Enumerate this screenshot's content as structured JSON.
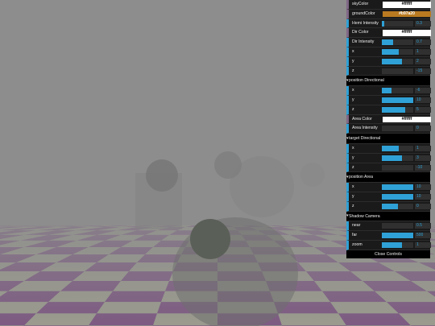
{
  "scene": {
    "colors": {
      "fog": "#8d8d8d",
      "floor_a": "#7d5a82",
      "floor_b": "#9a9a8e",
      "sphere": "#5a5a5a"
    }
  },
  "gui": {
    "colors": {
      "accent": "#2fa1d6",
      "bg": "#1a1a1a",
      "folder_bg": "#000000"
    },
    "rows": [
      {
        "kind": "color",
        "name": "skyColor-control",
        "label": "skyColor",
        "value": "#ffffff",
        "swatch": "#ffffff",
        "text_color": "#000000"
      },
      {
        "kind": "color",
        "name": "groundColor-control",
        "label": "groundColor",
        "value": "#b97a20",
        "swatch": "#b97a20",
        "text_color": "#ffffff"
      },
      {
        "kind": "slider",
        "name": "hemi-intensity-slider",
        "label": "Hemi Intensity",
        "value": "0.3",
        "fill": 0.08
      },
      {
        "kind": "color",
        "name": "dir-color-control",
        "label": "Dir Color",
        "value": "#ffffff",
        "swatch": "#ffffff",
        "text_color": "#000000"
      },
      {
        "kind": "slider",
        "name": "dir-intensity-slider",
        "label": "Dir Intensity",
        "value": "0.7",
        "fill": 0.35
      },
      {
        "kind": "slider",
        "name": "dir-x-slider",
        "label": "x",
        "value": "1",
        "fill": 0.55
      },
      {
        "kind": "slider",
        "name": "dir-y-slider",
        "label": "y",
        "value": "2",
        "fill": 0.65
      },
      {
        "kind": "slider",
        "name": "dir-z-slider",
        "label": "z",
        "value": "-15",
        "fill": 0.0
      },
      {
        "kind": "folder",
        "name": "folder-position-directional",
        "label": "position Directional"
      },
      {
        "kind": "slider",
        "name": "pos-dir-x-slider",
        "label": "x",
        "value": "-6",
        "fill": 0.3
      },
      {
        "kind": "slider",
        "name": "pos-dir-y-slider",
        "label": "y",
        "value": "10",
        "fill": 1.0
      },
      {
        "kind": "slider",
        "name": "pos-dir-z-slider",
        "label": "z",
        "value": "5",
        "fill": 0.75
      },
      {
        "kind": "color",
        "name": "area-color-control",
        "label": "Area Color",
        "value": "#ffffff",
        "swatch": "#ffffff",
        "text_color": "#000000"
      },
      {
        "kind": "slider",
        "name": "area-intensity-slider",
        "label": "Area Intensity",
        "value": "0",
        "fill": 0.0
      },
      {
        "kind": "folder",
        "name": "folder-target-directional",
        "label": "target Directional"
      },
      {
        "kind": "slider",
        "name": "tgt-dir-x-slider",
        "label": "x",
        "value": "1",
        "fill": 0.55
      },
      {
        "kind": "slider",
        "name": "tgt-dir-y-slider",
        "label": "y",
        "value": "3",
        "fill": 0.65
      },
      {
        "kind": "slider",
        "name": "tgt-dir-z-slider",
        "label": "z",
        "value": "-10",
        "fill": 0.0
      },
      {
        "kind": "folder",
        "name": "folder-position-area",
        "label": "position Area"
      },
      {
        "kind": "slider",
        "name": "pos-area-x-slider",
        "label": "x",
        "value": "10",
        "fill": 1.0
      },
      {
        "kind": "slider",
        "name": "pos-area-y-slider",
        "label": "y",
        "value": "10",
        "fill": 1.0
      },
      {
        "kind": "slider",
        "name": "pos-area-z-slider",
        "label": "z",
        "value": "0",
        "fill": 0.5
      },
      {
        "kind": "folder",
        "name": "folder-shadow-camera",
        "label": "Shadow Camera"
      },
      {
        "kind": "slider",
        "name": "shadow-near-slider",
        "label": "near",
        "value": "0.5",
        "fill": 0.0
      },
      {
        "kind": "slider",
        "name": "shadow-far-slider",
        "label": "far",
        "value": "500",
        "fill": 1.0
      },
      {
        "kind": "slider",
        "name": "shadow-zoom-slider",
        "label": "zoom",
        "value": "1",
        "fill": 0.65
      }
    ],
    "close_label": "Close Controls"
  }
}
